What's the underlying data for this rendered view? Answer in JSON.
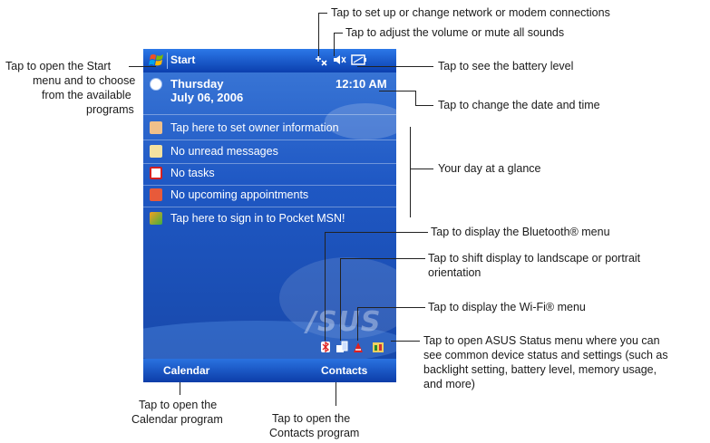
{
  "device": {
    "title_bar": {
      "start_label": "Start",
      "icons": [
        "network-icon",
        "volume-icon",
        "battery-icon"
      ]
    },
    "date_clock": {
      "day": "Thursday",
      "date": "July 06, 2006",
      "time": "12:10 AM"
    },
    "today_items": [
      {
        "icon": "owner-icon",
        "label": "Tap here to set owner information"
      },
      {
        "icon": "messages-icon",
        "label": "No unread messages"
      },
      {
        "icon": "tasks-icon",
        "label": "No tasks"
      },
      {
        "icon": "calendar-icon",
        "label": "No upcoming appointments"
      },
      {
        "icon": "msn-icon",
        "label": "Tap here to sign in to Pocket MSN!"
      }
    ],
    "watermark": "/SUS",
    "tray_icons": [
      "bluetooth-icon",
      "orientation-icon",
      "wifi-icon",
      "asus-status-icon"
    ],
    "softkeys": {
      "left": "Calendar",
      "right": "Contacts"
    }
  },
  "annotations": {
    "network": "Tap to set up or change network or modem connections",
    "volume": "Tap to adjust the volume or mute all sounds",
    "battery": "Tap to see the battery level",
    "start_line1": "Tap to open the Start",
    "start_line2": "menu and to choose",
    "start_line3": "from the available",
    "start_line4": "programs",
    "datetime": "Tap to change the date and time",
    "glance": "Your day at a glance",
    "bluetooth": "Tap to display the Bluetooth® menu",
    "orientation_line1": "Tap to shift display to landscape or portrait",
    "orientation_line2": "orientation",
    "wifi": "Tap to display the Wi-Fi® menu",
    "asus_line1": "Tap to open ASUS Status menu where you can",
    "asus_line2": "see common device status and settings (such as",
    "asus_line3": "backlight setting, battery level, memory usage,",
    "asus_line4": "and more)",
    "calendar_line1": "Tap to open the",
    "calendar_line2": "Calendar program",
    "contacts_line1": "Tap to open the",
    "contacts_line2": "Contacts program"
  }
}
